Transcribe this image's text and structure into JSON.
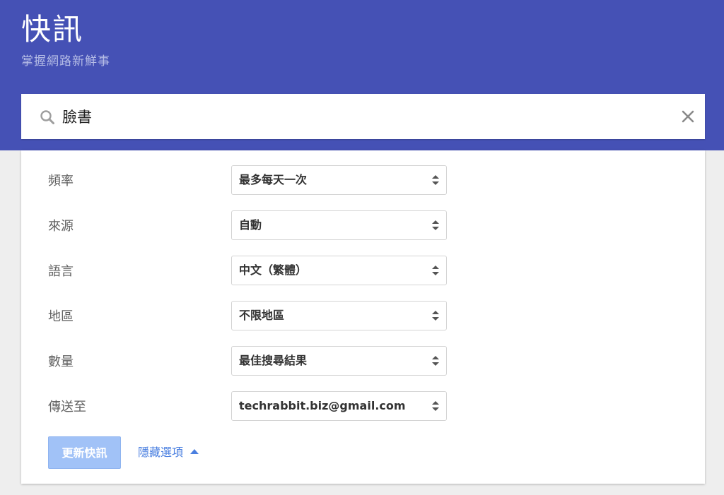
{
  "header": {
    "title": "快訊",
    "subtitle": "掌握網路新鮮事"
  },
  "search": {
    "value": "臉書",
    "icon": "search-icon",
    "clear_icon": "close-icon"
  },
  "options": [
    {
      "label": "頻率",
      "value": "最多每天一次"
    },
    {
      "label": "來源",
      "value": "自動"
    },
    {
      "label": "語言",
      "value": "中文（繁體）"
    },
    {
      "label": "地區",
      "value": "不限地區"
    },
    {
      "label": "數量",
      "value": "最佳搜尋結果"
    },
    {
      "label": "傳送至",
      "value": "techrabbit.biz@gmail.com"
    }
  ],
  "actions": {
    "update_label": "更新快訊",
    "hide_options_label": "隱藏選項"
  },
  "colors": {
    "header_bg": "#4551b5",
    "button_disabled_bg": "#a1c2f7",
    "link": "#4a7fe0"
  }
}
